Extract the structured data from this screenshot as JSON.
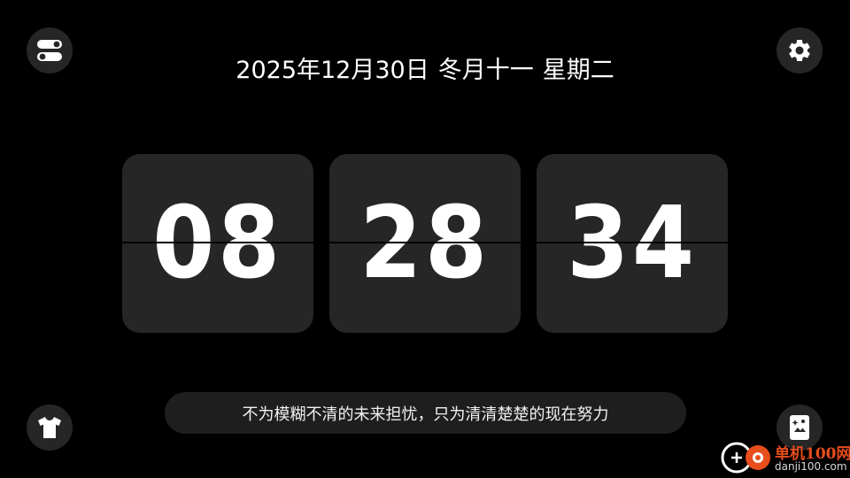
{
  "date": {
    "gregorian": "2025年12月30日",
    "lunar": "冬月十一",
    "weekday": "星期二"
  },
  "clock": {
    "hours": "08",
    "minutes": "28",
    "seconds": "34"
  },
  "quote": "不为模糊不清的未来担忧，只为清清楚楚的现在努力",
  "watermark": {
    "name": "单机100网",
    "url": "danji100.com"
  },
  "buttons": {
    "top_left": "toggle-icon",
    "top_right": "gear-icon",
    "bottom_left": "tshirt-icon",
    "bottom_right": "wallpaper-icon"
  },
  "colors": {
    "background": "#000000",
    "card": "#262626",
    "text": "#ffffff",
    "quote_bar": "#1e1e1e",
    "watermark_accent": "#e84d1c"
  }
}
